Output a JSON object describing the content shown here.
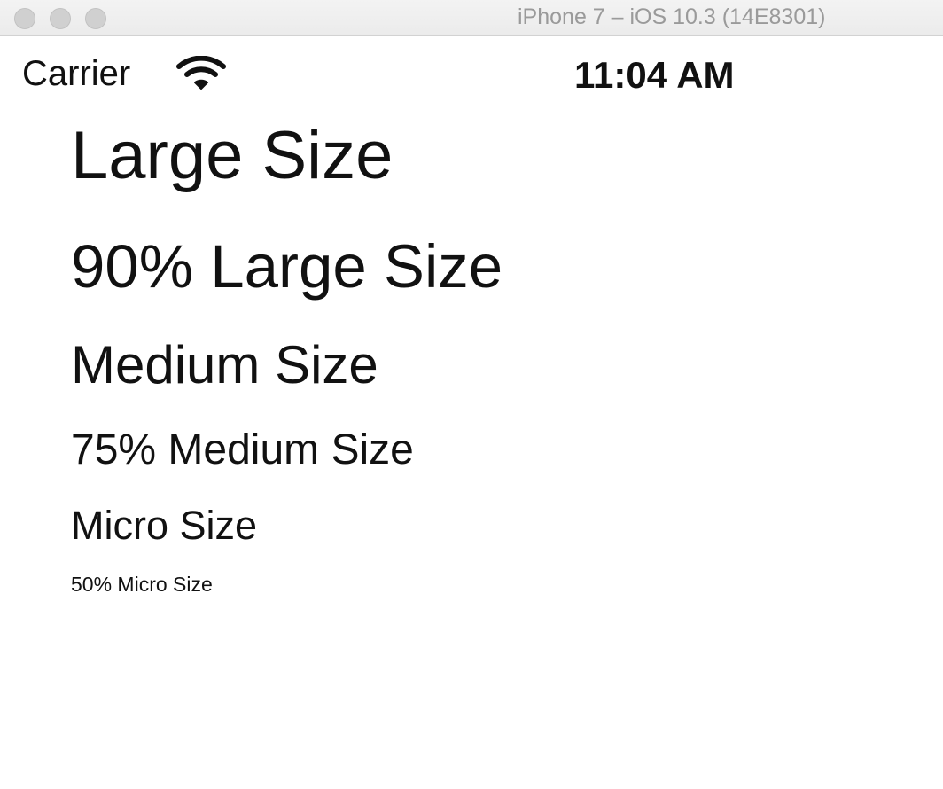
{
  "window": {
    "title": "iPhone 7 – iOS 10.3 (14E8301)"
  },
  "status_bar": {
    "carrier": "Carrier",
    "signal_icon": "wifi-icon",
    "time": "11:04 AM"
  },
  "labels": [
    {
      "text": "Large Size"
    },
    {
      "text": "90% Large Size"
    },
    {
      "text": "Medium Size"
    },
    {
      "text": "75% Medium Size"
    },
    {
      "text": "Micro Size"
    },
    {
      "text": "50% Micro Size"
    }
  ],
  "colors": {
    "text": "#111111",
    "title_text": "#9a9a9a",
    "traffic_light": "#d0d0d0",
    "background": "#ffffff"
  }
}
